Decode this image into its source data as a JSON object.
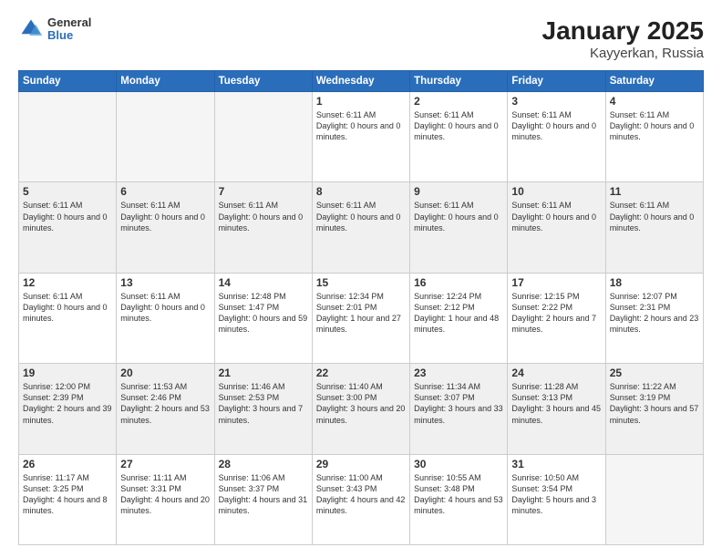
{
  "logo": {
    "general": "General",
    "blue": "Blue"
  },
  "header": {
    "month_year": "January 2025",
    "location": "Kayyerkan, Russia"
  },
  "weekdays": [
    "Sunday",
    "Monday",
    "Tuesday",
    "Wednesday",
    "Thursday",
    "Friday",
    "Saturday"
  ],
  "weeks": [
    {
      "shaded": false,
      "days": [
        {
          "num": "",
          "info": ""
        },
        {
          "num": "",
          "info": ""
        },
        {
          "num": "",
          "info": ""
        },
        {
          "num": "1",
          "info": "Sunset: 6:11 AM\nDaylight: 0 hours and 0 minutes."
        },
        {
          "num": "2",
          "info": "Sunset: 6:11 AM\nDaylight: 0 hours and 0 minutes."
        },
        {
          "num": "3",
          "info": "Sunset: 6:11 AM\nDaylight: 0 hours and 0 minutes."
        },
        {
          "num": "4",
          "info": "Sunset: 6:11 AM\nDaylight: 0 hours and 0 minutes."
        }
      ]
    },
    {
      "shaded": true,
      "days": [
        {
          "num": "5",
          "info": "Sunset: 6:11 AM\nDaylight: 0 hours and 0 minutes."
        },
        {
          "num": "6",
          "info": "Sunset: 6:11 AM\nDaylight: 0 hours and 0 minutes."
        },
        {
          "num": "7",
          "info": "Sunset: 6:11 AM\nDaylight: 0 hours and 0 minutes."
        },
        {
          "num": "8",
          "info": "Sunset: 6:11 AM\nDaylight: 0 hours and 0 minutes."
        },
        {
          "num": "9",
          "info": "Sunset: 6:11 AM\nDaylight: 0 hours and 0 minutes."
        },
        {
          "num": "10",
          "info": "Sunset: 6:11 AM\nDaylight: 0 hours and 0 minutes."
        },
        {
          "num": "11",
          "info": "Sunset: 6:11 AM\nDaylight: 0 hours and 0 minutes."
        }
      ]
    },
    {
      "shaded": false,
      "days": [
        {
          "num": "12",
          "info": "Sunset: 6:11 AM\nDaylight: 0 hours and 0 minutes."
        },
        {
          "num": "13",
          "info": "Sunset: 6:11 AM\nDaylight: 0 hours and 0 minutes."
        },
        {
          "num": "14",
          "info": "Sunrise: 12:48 PM\nSunset: 1:47 PM\nDaylight: 0 hours and 59 minutes."
        },
        {
          "num": "15",
          "info": "Sunrise: 12:34 PM\nSunset: 2:01 PM\nDaylight: 1 hour and 27 minutes."
        },
        {
          "num": "16",
          "info": "Sunrise: 12:24 PM\nSunset: 2:12 PM\nDaylight: 1 hour and 48 minutes."
        },
        {
          "num": "17",
          "info": "Sunrise: 12:15 PM\nSunset: 2:22 PM\nDaylight: 2 hours and 7 minutes."
        },
        {
          "num": "18",
          "info": "Sunrise: 12:07 PM\nSunset: 2:31 PM\nDaylight: 2 hours and 23 minutes."
        }
      ]
    },
    {
      "shaded": true,
      "days": [
        {
          "num": "19",
          "info": "Sunrise: 12:00 PM\nSunset: 2:39 PM\nDaylight: 2 hours and 39 minutes."
        },
        {
          "num": "20",
          "info": "Sunrise: 11:53 AM\nSunset: 2:46 PM\nDaylight: 2 hours and 53 minutes."
        },
        {
          "num": "21",
          "info": "Sunrise: 11:46 AM\nSunset: 2:53 PM\nDaylight: 3 hours and 7 minutes."
        },
        {
          "num": "22",
          "info": "Sunrise: 11:40 AM\nSunset: 3:00 PM\nDaylight: 3 hours and 20 minutes."
        },
        {
          "num": "23",
          "info": "Sunrise: 11:34 AM\nSunset: 3:07 PM\nDaylight: 3 hours and 33 minutes."
        },
        {
          "num": "24",
          "info": "Sunrise: 11:28 AM\nSunset: 3:13 PM\nDaylight: 3 hours and 45 minutes."
        },
        {
          "num": "25",
          "info": "Sunrise: 11:22 AM\nSunset: 3:19 PM\nDaylight: 3 hours and 57 minutes."
        }
      ]
    },
    {
      "shaded": false,
      "days": [
        {
          "num": "26",
          "info": "Sunrise: 11:17 AM\nSunset: 3:25 PM\nDaylight: 4 hours and 8 minutes."
        },
        {
          "num": "27",
          "info": "Sunrise: 11:11 AM\nSunset: 3:31 PM\nDaylight: 4 hours and 20 minutes."
        },
        {
          "num": "28",
          "info": "Sunrise: 11:06 AM\nSunset: 3:37 PM\nDaylight: 4 hours and 31 minutes."
        },
        {
          "num": "29",
          "info": "Sunrise: 11:00 AM\nSunset: 3:43 PM\nDaylight: 4 hours and 42 minutes."
        },
        {
          "num": "30",
          "info": "Sunrise: 10:55 AM\nSunset: 3:48 PM\nDaylight: 4 hours and 53 minutes."
        },
        {
          "num": "31",
          "info": "Sunrise: 10:50 AM\nSunset: 3:54 PM\nDaylight: 5 hours and 3 minutes."
        },
        {
          "num": "",
          "info": ""
        }
      ]
    }
  ]
}
